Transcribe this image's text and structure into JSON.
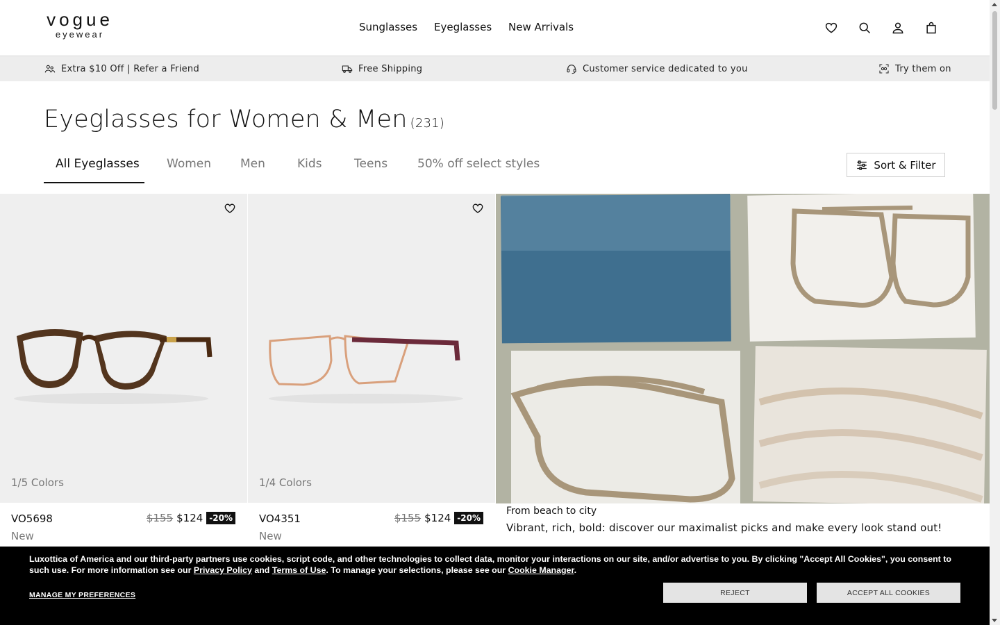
{
  "brand": {
    "line1": "vogue",
    "line2": "eyewear"
  },
  "nav": {
    "items": [
      "Sunglasses",
      "Eyeglasses",
      "New Arrivals"
    ]
  },
  "header_icons": [
    "heart-icon",
    "search-icon",
    "user-icon",
    "bag-icon"
  ],
  "promo": {
    "items": [
      {
        "icon": "refer-icon",
        "label": "Extra $10 Off | Refer a Friend"
      },
      {
        "icon": "truck-icon",
        "label": "Free Shipping"
      },
      {
        "icon": "headset-icon",
        "label": "Customer service dedicated to you"
      },
      {
        "icon": "try-on-icon",
        "label": "Try them on"
      }
    ]
  },
  "page": {
    "title": "Eyeglasses for Women & Men",
    "count": "(231)"
  },
  "tabs": [
    "All Eyeglasses",
    "Women",
    "Men",
    "Kids",
    "Teens",
    "50% off select styles"
  ],
  "active_tab": 0,
  "sort_filter_label": "Sort & Filter",
  "products": [
    {
      "colors": "1/5 Colors",
      "name": "VO5698",
      "tag": "New",
      "old_price": "$155",
      "price": "$124",
      "discount": "-20%",
      "frame_color": "#4a2a12"
    },
    {
      "colors": "1/4 Colors",
      "name": "VO4351",
      "tag": "New",
      "old_price": "$155",
      "price": "$124",
      "discount": "-20%",
      "frame_color": "#d9a07c"
    }
  ],
  "editorial": {
    "caption": "From beach to city",
    "text": "Vibrant, rich, bold: discover our maximalist picks and make every look stand out!"
  },
  "cookie": {
    "text_a": "Luxottica of America and our third-party partners use cookies, script code, and other technologies to collect data, monitor your interactions on our site, and/or advertise to you. By clicking \"Accept All Cookies\", you consent to such use. For more information see our ",
    "privacy": "Privacy Policy",
    "and": " and ",
    "terms": "Terms of Use",
    "text_b": ". To manage your selections, please see our ",
    "manager": "Cookie Manager",
    "end": ".",
    "manage_prefs": "MANAGE MY PREFERENCES",
    "reject": "REJECT",
    "accept": "ACCEPT ALL COOKIES"
  }
}
